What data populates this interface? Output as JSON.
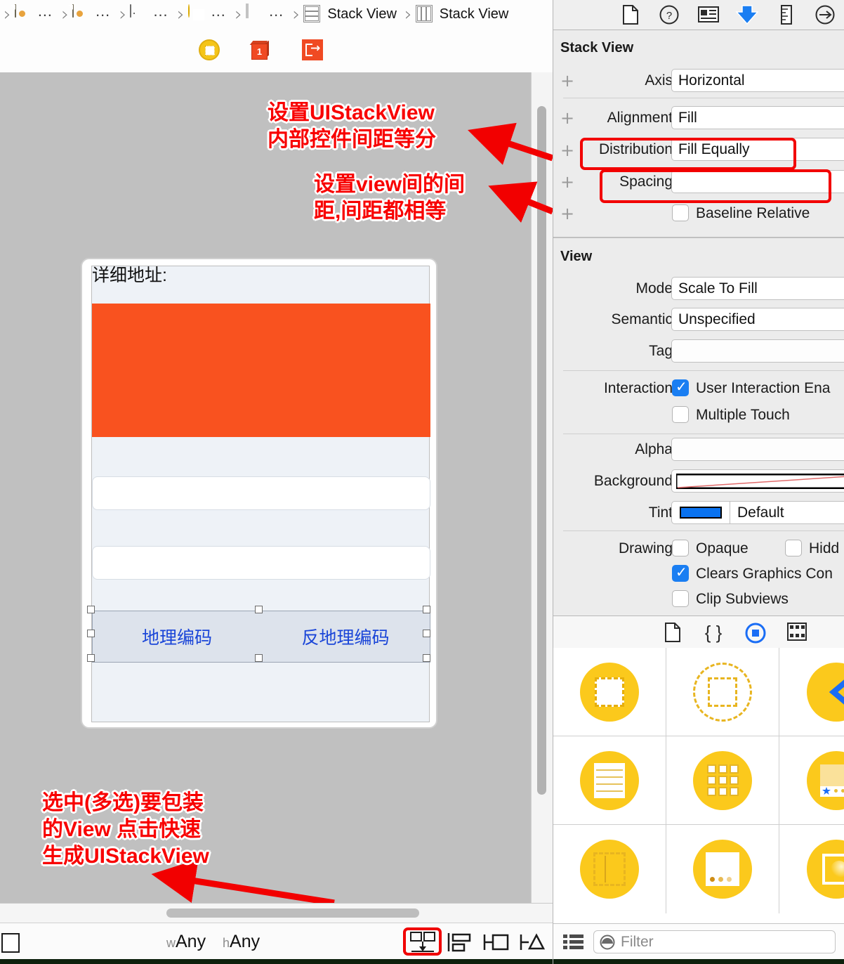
{
  "breadcrumb": {
    "items": [
      {
        "icon": "swift-file-icon",
        "label": "…"
      },
      {
        "icon": "swift-file-icon",
        "label": "…"
      },
      {
        "icon": "storyboard-icon",
        "label": "…"
      },
      {
        "icon": "view-controller-icon",
        "label": "…"
      },
      {
        "icon": "view-icon",
        "label": "…"
      },
      {
        "icon": "stack-view-vertical-icon",
        "label": "Stack View"
      },
      {
        "icon": "stack-view-horizontal-icon",
        "label": "Stack View"
      }
    ]
  },
  "canvas_toolbar": {
    "view_controller_label": "view-controller-scene-icon",
    "first_responder_label": "first-responder-icon",
    "exit_label": "exit-icon"
  },
  "annotations": {
    "note_distribution": "设置UIStackView\n内部控件间距等分",
    "note_spacing": "设置view间的间\n距,间距都相等",
    "note_embed": "选中(多选)要包装\n的View 点击快速\n生成UIStackView",
    "highlight_color": "#f20000"
  },
  "device": {
    "address_label": "详细地址:",
    "orange_block_color": "#f9521f",
    "text_field_1": "",
    "text_field_2": "",
    "stack_buttons": [
      "地理编码",
      "反地理编码"
    ]
  },
  "inspector": {
    "tabs": [
      {
        "name": "file-inspector-tab",
        "icon": "document-icon",
        "selected": false
      },
      {
        "name": "quick-help-tab",
        "icon": "question-circle-icon",
        "selected": false
      },
      {
        "name": "identity-inspector-tab",
        "icon": "id-card-icon",
        "selected": false
      },
      {
        "name": "attributes-inspector-tab",
        "icon": "down-arrow-icon",
        "selected": true
      },
      {
        "name": "size-inspector-tab",
        "icon": "ruler-icon",
        "selected": false
      },
      {
        "name": "connections-inspector-tab",
        "icon": "arrow-circle-icon",
        "selected": false
      }
    ],
    "stack_view": {
      "title": "Stack View",
      "axis": {
        "label": "Axis",
        "value": "Horizontal"
      },
      "alignment": {
        "label": "Alignment",
        "value": "Fill"
      },
      "distribution": {
        "label": "Distribution",
        "value": "Fill Equally",
        "highlighted": true
      },
      "spacing": {
        "label": "Spacing",
        "value": "",
        "highlighted": true
      },
      "baseline_relative": {
        "label": "Baseline Relative",
        "checked": false
      }
    },
    "view": {
      "title": "View",
      "mode": {
        "label": "Mode",
        "value": "Scale To Fill"
      },
      "semantic": {
        "label": "Semantic",
        "value": "Unspecified"
      },
      "tag": {
        "label": "Tag",
        "value": ""
      },
      "interaction": {
        "label": "Interaction",
        "user_interaction_enabled": {
          "label": "User Interaction Ena",
          "checked": true
        },
        "multiple_touch": {
          "label": "Multiple Touch",
          "checked": false
        }
      },
      "alpha": {
        "label": "Alpha",
        "value": ""
      },
      "background": {
        "label": "Background",
        "value": ""
      },
      "tint": {
        "label": "Tint",
        "value": "Default",
        "swatch": "#0a72f0"
      },
      "drawing": {
        "label": "Drawing",
        "opaque": {
          "label": "Opaque",
          "checked": false
        },
        "hidden": {
          "label": "Hidd",
          "checked": false
        },
        "clears_graphics_context": {
          "label": "Clears Graphics Con",
          "checked": true
        },
        "clip_subviews": {
          "label": "Clip Subviews",
          "checked": false
        }
      }
    }
  },
  "library": {
    "tabs": [
      {
        "name": "file-template-library-tab",
        "icon": "document-icon",
        "selected": false
      },
      {
        "name": "code-snippet-library-tab",
        "icon": "braces-icon",
        "selected": false
      },
      {
        "name": "object-library-tab",
        "icon": "circle-square-icon",
        "selected": true
      },
      {
        "name": "media-library-tab",
        "icon": "filmstrip-icon",
        "selected": false
      }
    ],
    "items": [
      {
        "name": "view-object",
        "icon": "dashed-square-in-circle-icon"
      },
      {
        "name": "container-view-object",
        "icon": "dashed-circle-square-icon"
      },
      {
        "name": "navigation-bar-object",
        "icon": "back-chevron-icon"
      },
      {
        "name": "table-view-object",
        "icon": "lined-page-icon"
      },
      {
        "name": "collection-view-object",
        "icon": "grid-icon"
      },
      {
        "name": "tab-bar-object",
        "icon": "star-tabbar-icon"
      },
      {
        "name": "split-view-object",
        "icon": "split-panel-icon"
      },
      {
        "name": "page-control-object",
        "icon": "dots-panel-icon"
      },
      {
        "name": "image-view-object",
        "icon": "sphere-panel-icon"
      }
    ],
    "filter": {
      "placeholder": "Filter",
      "value": ""
    }
  },
  "bottom_bar": {
    "size_class_w_prefix": "w",
    "size_class_w": "Any",
    "size_class_h_prefix": "h",
    "size_class_h": "Any",
    "buttons": [
      {
        "name": "embed-in-stack-button",
        "icon": "embed-in-icon",
        "highlighted": true
      },
      {
        "name": "align-button",
        "icon": "align-icon"
      },
      {
        "name": "pin-button",
        "icon": "pin-icon"
      },
      {
        "name": "resolve-auto-layout-button",
        "icon": "resolve-icon"
      }
    ]
  }
}
